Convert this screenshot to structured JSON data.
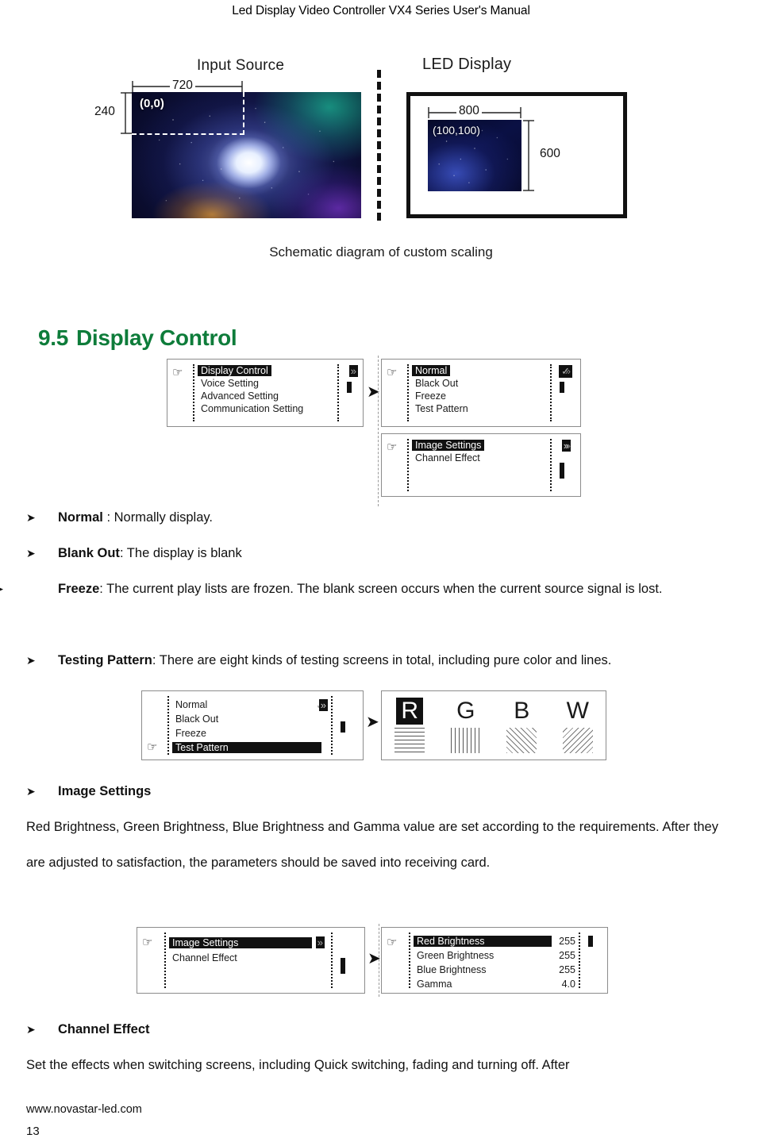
{
  "header": {
    "title": "Led Display Video Controller VX4 Series User's Manual"
  },
  "schematic": {
    "left_title": "Input Source",
    "right_title": "LED Display",
    "input_width": "720",
    "input_height": "240",
    "input_origin": "(0,0)",
    "led_width": "800",
    "led_height": "600",
    "led_origin": "(100,100)",
    "caption": "Schematic diagram of custom scaling"
  },
  "section": {
    "number": "9.5",
    "title": "Display Control"
  },
  "figure_main_menu": {
    "left_panel": {
      "rows": [
        {
          "label": "Display Control",
          "chevron": "»",
          "selected": true
        },
        {
          "label": "Voice Setting",
          "chevron": "»",
          "selected": false
        },
        {
          "label": "Advanced Setting",
          "chevron": "»",
          "selected": false
        },
        {
          "label": "Communication Setting",
          "chevron": "»",
          "selected": false
        }
      ]
    },
    "right_panel_top": {
      "rows": [
        {
          "label": "Normal",
          "mark": "✓",
          "selected": true
        },
        {
          "label": "Black Out",
          "mark": "",
          "selected": false
        },
        {
          "label": "Freeze",
          "mark": "",
          "selected": false
        },
        {
          "label": "Test Pattern",
          "mark": "»",
          "selected": false
        }
      ]
    },
    "right_panel_bottom": {
      "rows": [
        {
          "label": "Image Settings",
          "mark": "»",
          "selected": true
        },
        {
          "label": "Channel Effect",
          "mark": "»",
          "selected": false
        }
      ]
    }
  },
  "bullets": [
    {
      "marker": "➤",
      "term": "Normal",
      "rest": " : Normally display."
    },
    {
      "marker": "➤",
      "term": "Blank Out",
      "rest": ": The display is blank"
    },
    {
      "marker": "➤",
      "term": "Freeze",
      "rest": ": The current play lists are frozen. The blank screen occurs when the current source signal is lost."
    },
    {
      "marker": "➤",
      "term": "Testing Pattern",
      "rest": ": There are eight kinds of testing screens in total, including pure color and lines."
    }
  ],
  "figure_test_pattern": {
    "menu_rows": [
      {
        "label": "Normal",
        "mark": "✓",
        "selected": false
      },
      {
        "label": "Black Out",
        "mark": "",
        "selected": false
      },
      {
        "label": "Freeze",
        "mark": "",
        "selected": false
      },
      {
        "label": "Test Pattern",
        "mark": "»",
        "selected": true
      }
    ],
    "patterns": [
      {
        "letter": "R",
        "inverted": true,
        "pattern": "horizontal-lines"
      },
      {
        "letter": "G",
        "inverted": false,
        "pattern": "vertical-lines"
      },
      {
        "letter": "B",
        "inverted": false,
        "pattern": "diagonal-lines-up"
      },
      {
        "letter": "W",
        "inverted": false,
        "pattern": "diagonal-lines-down"
      }
    ]
  },
  "image_settings": {
    "bullet_marker": "➤",
    "bullet_title": "Image Settings",
    "paragraph": "Red Brightness, Green Brightness, Blue Brightness and Gamma value are set according to the requirements. After they are adjusted to satisfaction, the parameters should be saved into receiving card."
  },
  "figure_image_settings": {
    "left_panel": {
      "rows": [
        {
          "label": "Image Settings",
          "mark": "»",
          "selected": true
        },
        {
          "label": "Channel Effect",
          "mark": "»",
          "selected": false
        }
      ]
    },
    "right_panel": {
      "rows": [
        {
          "label": "Red Brightness",
          "value": "255",
          "selected": true
        },
        {
          "label": "Green Brightness",
          "value": "255",
          "selected": false
        },
        {
          "label": "Blue Brightness",
          "value": "255",
          "selected": false
        },
        {
          "label": "Gamma",
          "value": "4.0",
          "selected": false
        }
      ]
    }
  },
  "channel_effect": {
    "bullet_marker": "➤",
    "bullet_title": "Channel Effect",
    "paragraph": "Set the effects when switching screens, including Quick switching, fading and turning off. After"
  },
  "footer": {
    "url": "www.novastar-led.com",
    "page": "13"
  },
  "colors": {
    "heading_green": "#0E7C3A",
    "text_black": "#111111"
  }
}
